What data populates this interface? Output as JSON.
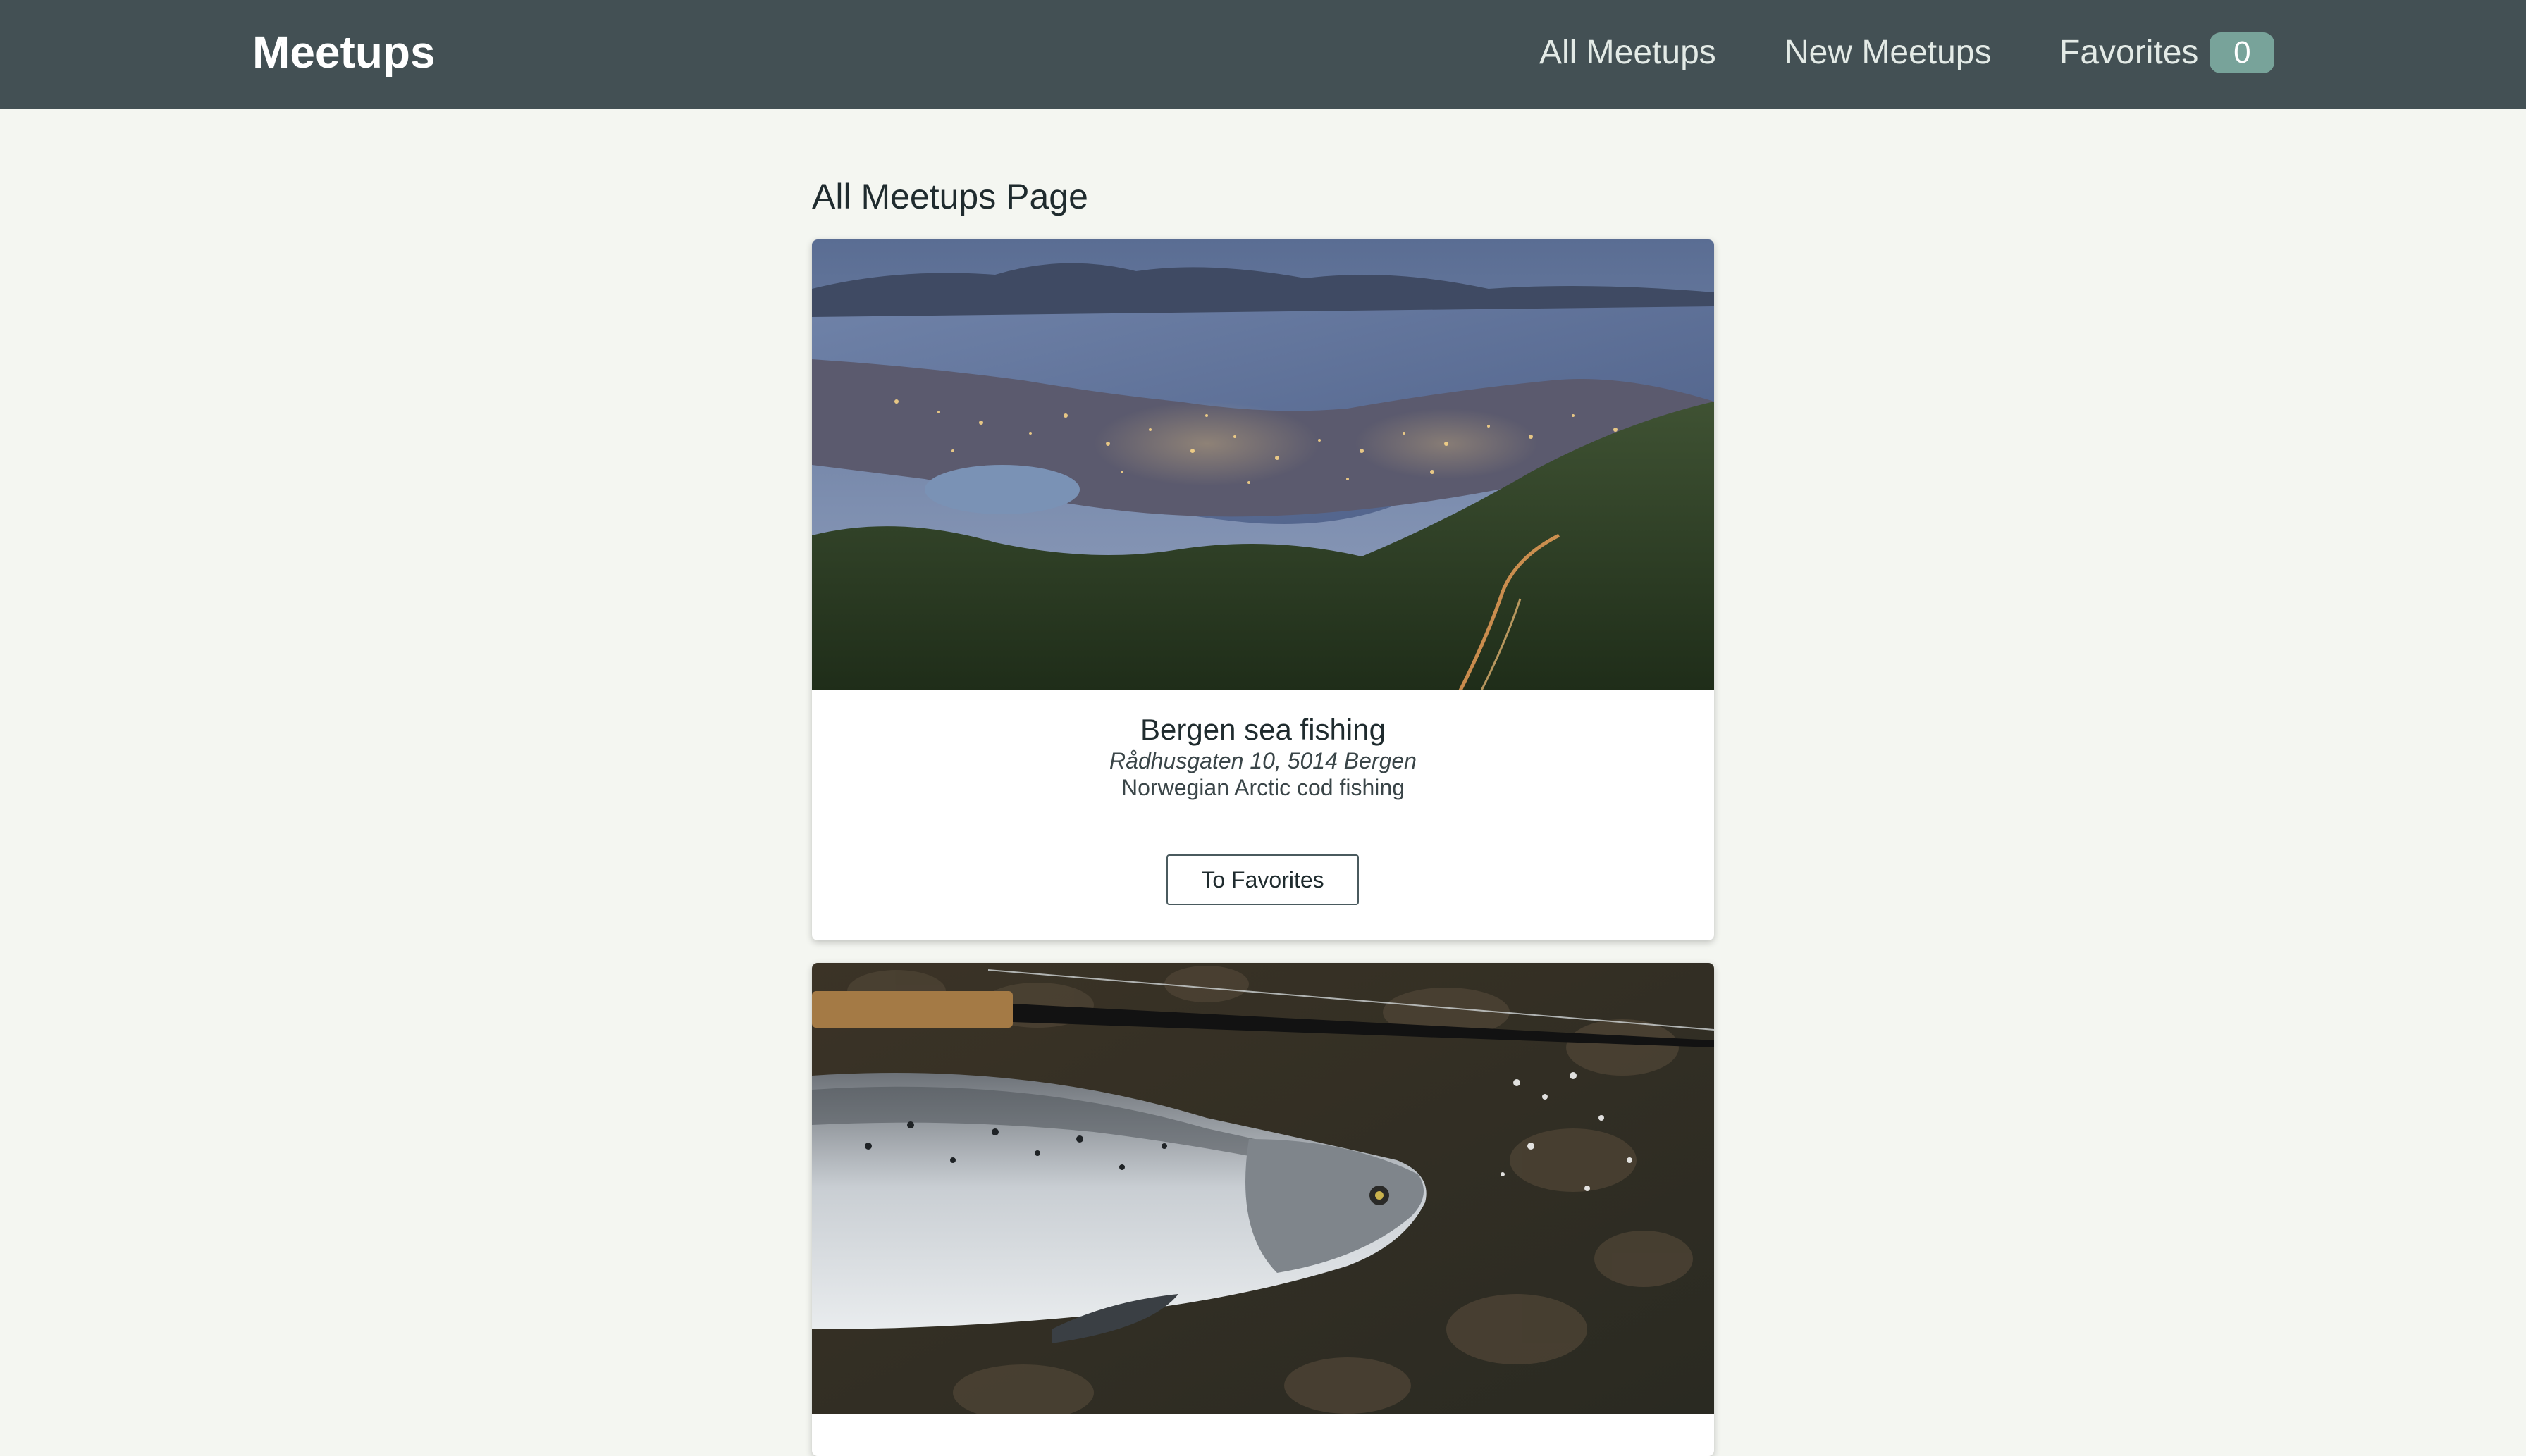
{
  "header": {
    "logo": "Meetups",
    "nav": {
      "all_meetups": "All Meetups",
      "new_meetups": "New Meetups",
      "favorites": "Favorites",
      "favorites_count": "0"
    }
  },
  "main": {
    "page_title": "All Meetups Page",
    "meetups": [
      {
        "title": "Bergen sea fishing",
        "address": "Rådhusgaten 10, 5014 Bergen",
        "description": "Norwegian Arctic cod fishing",
        "button_label": "To Favorites",
        "image": "city-harbor-night-photo"
      },
      {
        "image": "salmon-fishing-rod-photo"
      }
    ]
  },
  "colors": {
    "header_bg": "#435054",
    "page_bg": "#f4f6f1",
    "badge_bg": "#78a39a",
    "card_bg": "#ffffff"
  }
}
